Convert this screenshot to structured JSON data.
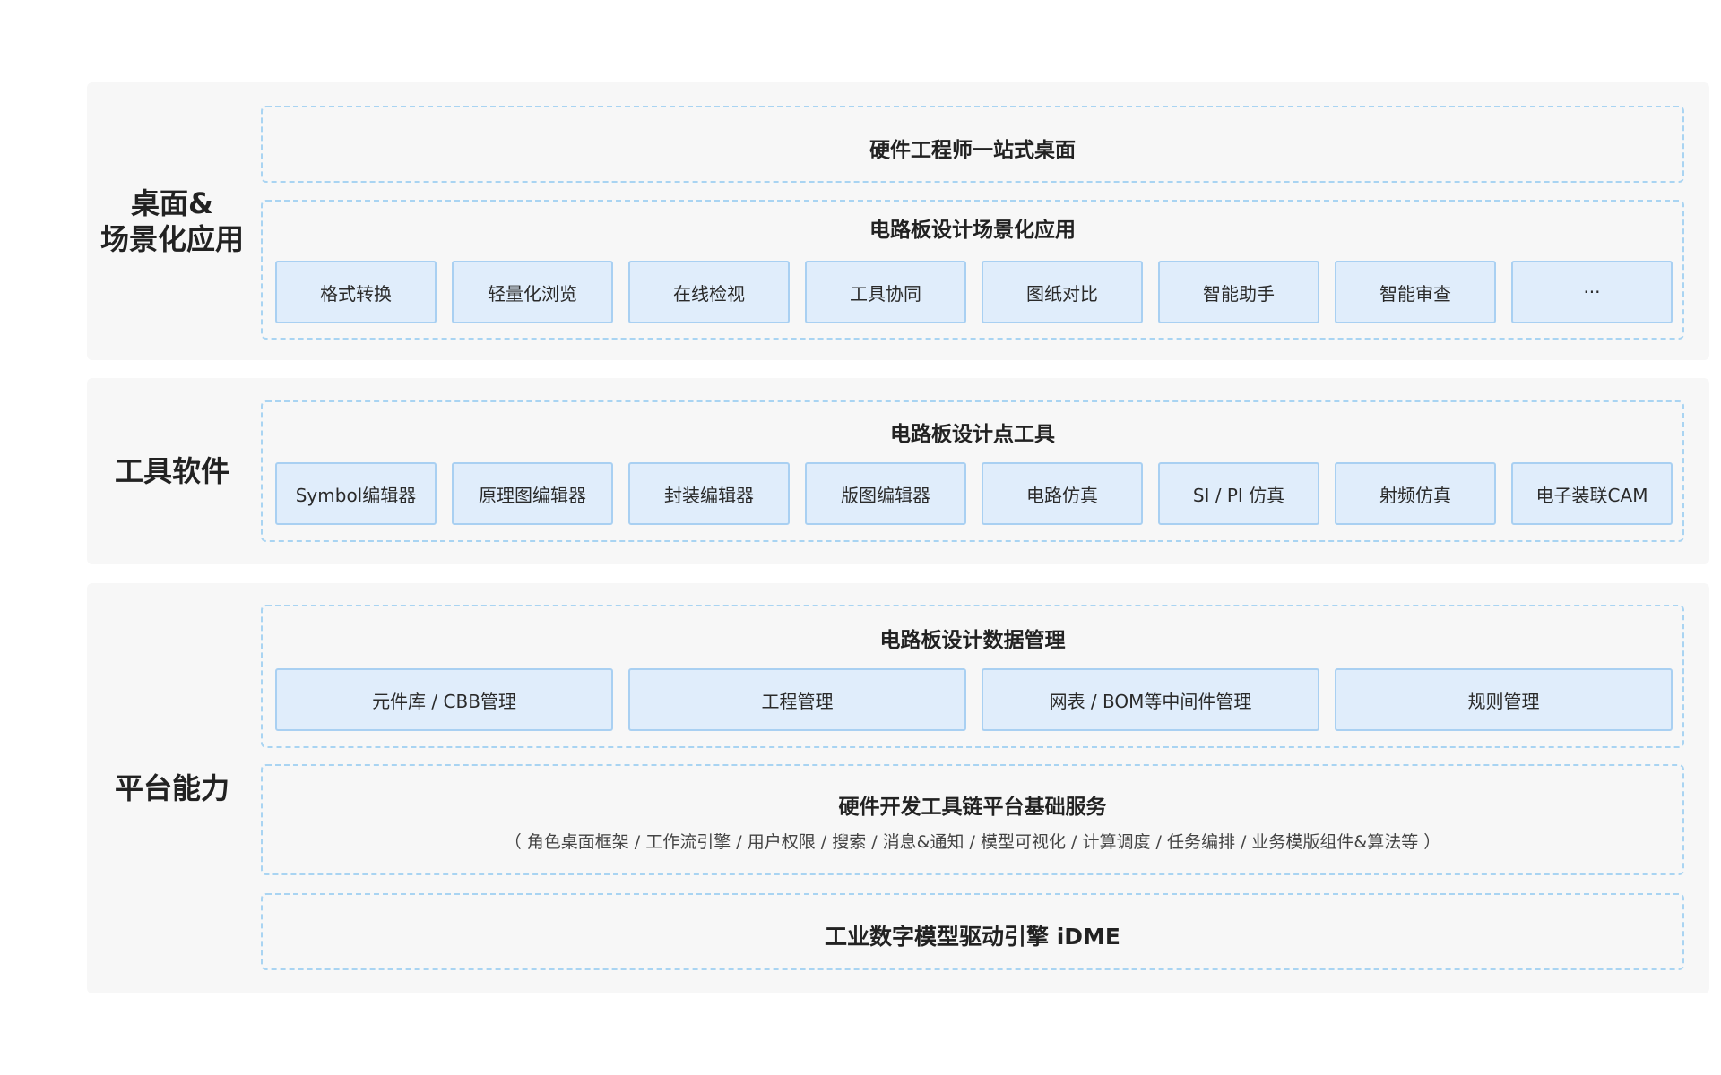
{
  "layers": [
    {
      "title_lines": [
        "桌面&",
        "场景化应用"
      ],
      "groups": [
        {
          "title": "硬件工程师一站式桌面"
        },
        {
          "title": "电路板设计场景化应用",
          "items": [
            "格式转换",
            "轻量化浏览",
            "在线检视",
            "工具协同",
            "图纸对比",
            "智能助手",
            "智能审查",
            "···"
          ]
        }
      ]
    },
    {
      "title_lines": [
        "工具软件"
      ],
      "groups": [
        {
          "title": "电路板设计点工具",
          "items": [
            "Symbol编辑器",
            "原理图编辑器",
            "封装编辑器",
            "版图编辑器",
            "电路仿真",
            "SI / PI 仿真",
            "射频仿真",
            "电子装联CAM"
          ]
        }
      ]
    },
    {
      "title_lines": [
        "平台能力"
      ],
      "groups": [
        {
          "title": "电路板设计数据管理",
          "items": [
            "元件库 / CBB管理",
            "工程管理",
            "网表 / BOM等中间件管理",
            "规则管理"
          ]
        },
        {
          "title": "硬件开发工具链平台基础服务",
          "subtitle": "（ 角色桌面框架 / 工作流引擎 / 用户权限 / 搜索 / 消息&通知 / 模型可视化 / 计算调度 / 任务编排 / 业务模版组件&算法等 ）"
        },
        {
          "title": "工业数字模型驱动引擎 iDME"
        }
      ]
    }
  ],
  "colors": {
    "layer_bg": "#f7f7f7",
    "dashed_border": "#a9d4f2",
    "box_fill": "#e0edfb",
    "box_border": "#a9d0f2"
  }
}
